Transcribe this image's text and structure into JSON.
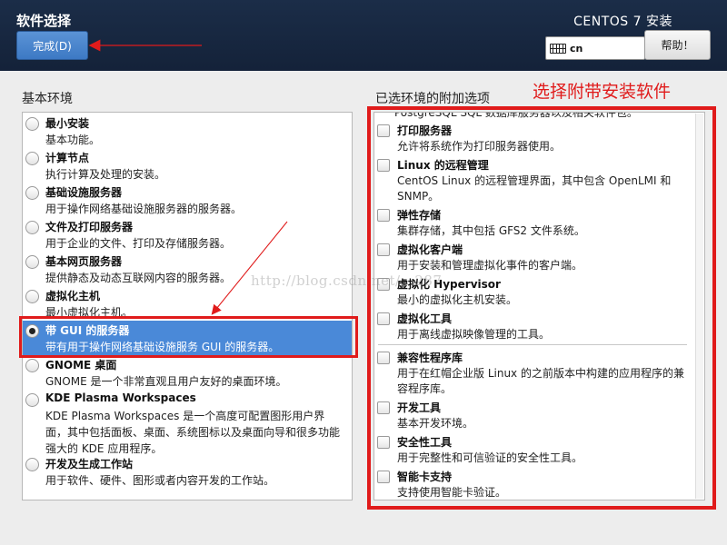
{
  "header": {
    "title": "软件选择",
    "done_label": "完成(D)",
    "product": "CENTOS 7 安装",
    "keyboard_layout": "cn",
    "help_label": "帮助！"
  },
  "base_env": {
    "heading": "基本环境",
    "selected_index": 6,
    "items": [
      {
        "name": "最小安装",
        "desc": "基本功能。"
      },
      {
        "name": "计算节点",
        "desc": "执行计算及处理的安装。"
      },
      {
        "name": "基础设施服务器",
        "desc": "用于操作网络基础设施服务器的服务器。"
      },
      {
        "name": "文件及打印服务器",
        "desc": "用于企业的文件、打印及存储服务器。"
      },
      {
        "name": "基本网页服务器",
        "desc": "提供静态及动态互联网内容的服务器。"
      },
      {
        "name": "虚拟化主机",
        "desc": "最小虚拟化主机。"
      },
      {
        "name": "带 GUI 的服务器",
        "desc": "带有用于操作网络基础设施服务 GUI 的服务器。"
      },
      {
        "name": "GNOME 桌面",
        "desc": "GNOME 是一个非常直观且用户友好的桌面环境。"
      },
      {
        "name": "KDE Plasma Workspaces",
        "desc": "KDE Plasma Workspaces 是一个高度可配置图形用户界面，其中包括面板、桌面、系统图标以及桌面向导和很多功能强大的 KDE 应用程序。"
      },
      {
        "name": "开发及生成工作站",
        "desc": "用于软件、硬件、图形或者内容开发的工作站。"
      }
    ]
  },
  "addons": {
    "heading": "已选环境的附加选项",
    "partial_top": "PostgreSQL SQL 数据库服务器以及相关软件包。",
    "items": [
      {
        "name": "打印服务器",
        "desc": "允许将系统作为打印服务器使用。"
      },
      {
        "name": "Linux 的远程管理",
        "desc": "CentOS Linux 的远程管理界面，其中包含 OpenLMI 和 SNMP。"
      },
      {
        "name": "弹性存储",
        "desc": "集群存储，其中包括 GFS2 文件系统。"
      },
      {
        "name": "虚拟化客户端",
        "desc": "用于安装和管理虚拟化事件的客户端。"
      },
      {
        "name": "虚拟化 Hypervisor",
        "desc": "最小的虚拟化主机安装。"
      },
      {
        "name": "虚拟化工具",
        "desc": "用于离线虚拟映像管理的工具。"
      },
      {
        "name": "兼容性程序库",
        "desc": "用于在红帽企业版 Linux 的之前版本中构建的应用程序的兼容程序库。"
      },
      {
        "name": "开发工具",
        "desc": "基本开发环境。"
      },
      {
        "name": "安全性工具",
        "desc": "用于完整性和可信验证的安全性工具。"
      },
      {
        "name": "智能卡支持",
        "desc": "支持使用智能卡验证。"
      }
    ]
  },
  "annotation": {
    "note": "选择附带安装软件",
    "color": "#e01b1b"
  },
  "watermark": "http://blog.csdn.net/...287"
}
